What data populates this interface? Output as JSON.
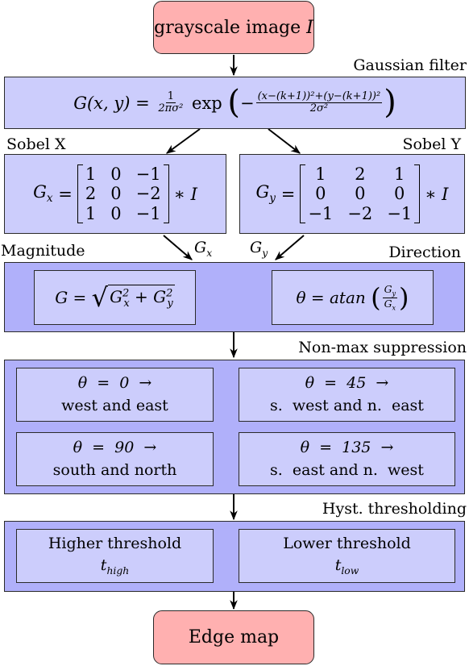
{
  "nodes": {
    "input": {
      "text": "grayscale image",
      "symbol": "I"
    },
    "gaussian": {
      "label": "Gaussian filter",
      "lhs": "G(x, y) =",
      "frac_num": "1",
      "frac_den": "2πσ²",
      "fn": "exp",
      "inner_num": "(x−(k+1))²+(y−(k+1))²",
      "inner_den": "2σ²",
      "minus": "−"
    },
    "sobel_x": {
      "label": "Sobel X",
      "lhs": "G",
      "lhs_sub": "x",
      "eq": "=",
      "matrix": [
        "1",
        "0",
        "−1",
        "2",
        "0",
        "−2",
        "1",
        "0",
        "−1"
      ],
      "rhs": "∗ I"
    },
    "sobel_y": {
      "label": "Sobel Y",
      "lhs": "G",
      "lhs_sub": "y",
      "eq": "=",
      "matrix": [
        "1",
        "2",
        "1",
        "0",
        "0",
        "0",
        "−1",
        "−2",
        "−1"
      ],
      "rhs": "∗ I"
    },
    "gradient": {
      "magnitude_label": "Magnitude",
      "direction_label": "Direction",
      "edge_gx": "G",
      "edge_gx_sub": "x",
      "edge_gy": "G",
      "edge_gy_sub": "y",
      "magnitude_formula": {
        "lhs": "G =",
        "t1": "G",
        "t1_sub": "x",
        "t1_sup": "2",
        "plus": "+",
        "t2": "G",
        "t2_sub": "y",
        "t2_sup": "2"
      },
      "direction_formula": {
        "lhs": "θ = atan",
        "num": "G",
        "num_sub": "y",
        "den": "G",
        "den_sub": "x"
      }
    },
    "nonmax": {
      "label": "Non-max suppression",
      "cells": [
        {
          "line1": "θ  =  0  →",
          "line2": "west and east"
        },
        {
          "line1": "θ  =  45  →",
          "line2": "s.  west and n.  east"
        },
        {
          "line1": "θ  =  90  →",
          "line2": "south and north"
        },
        {
          "line1": "θ  =  135  →",
          "line2": "s.  east and n.  west"
        }
      ]
    },
    "hyst": {
      "label": "Hyst. thresholding",
      "cells": [
        {
          "line1": "Higher threshold",
          "sym": "t",
          "sub": "high"
        },
        {
          "line1": "Lower threshold",
          "sym": "t",
          "sub": "low"
        }
      ]
    },
    "output": {
      "text": "Edge map"
    }
  },
  "colors": {
    "terminal_fill": "#ffb0b0",
    "group_fill": "#b0b0fa",
    "box_fill": "#cccdfc",
    "stroke": "#2a2a2a"
  }
}
